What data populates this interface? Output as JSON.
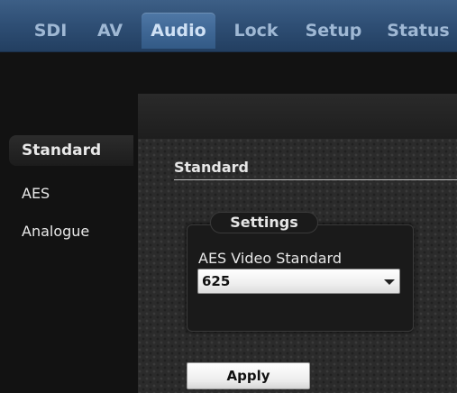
{
  "nav": {
    "tabs": [
      {
        "label": "SDI"
      },
      {
        "label": "AV"
      },
      {
        "label": "Audio",
        "active": true
      },
      {
        "label": "Lock"
      },
      {
        "label": "Setup"
      },
      {
        "label": "Status"
      }
    ]
  },
  "sidebar": {
    "items": [
      {
        "label": "Standard",
        "active": true
      },
      {
        "label": "AES"
      },
      {
        "label": "Analogue"
      }
    ]
  },
  "main": {
    "section_title": "Standard",
    "settings": {
      "title": "Settings",
      "field_label": "AES Video Standard",
      "selected_value": "625"
    },
    "apply_label": "Apply"
  },
  "colors": {
    "nav_blue": "#2e4e74",
    "active_tab": "#3e6694",
    "background": "#121212"
  }
}
